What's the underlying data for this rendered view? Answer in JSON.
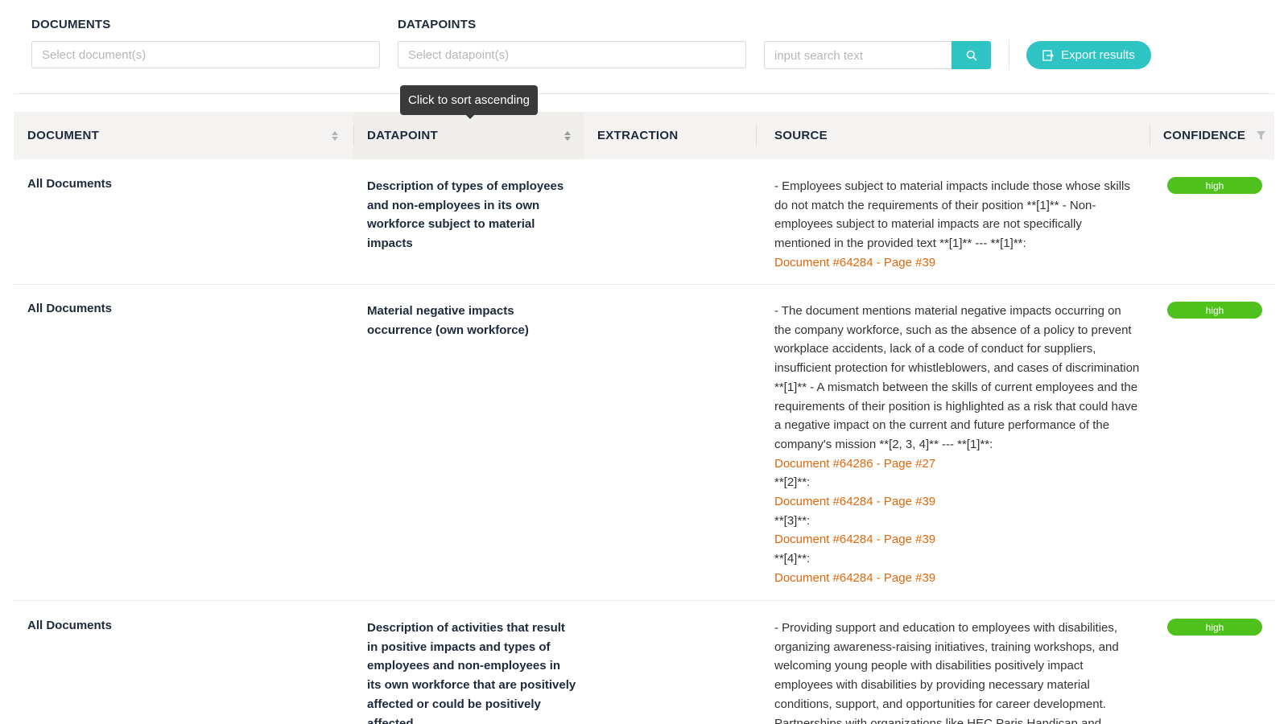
{
  "filters": {
    "documents_label": "DOCUMENTS",
    "documents_placeholder": "Select document(s)",
    "datapoints_label": "DATAPOINTS",
    "datapoints_placeholder": "Select datapoint(s)",
    "search_placeholder": "input search text",
    "export_label": "Export results"
  },
  "colors": {
    "accent": "#2fc4c4",
    "link": "#e2670a",
    "badge_high": "#4fc11d"
  },
  "tooltip": "Click to sort ascending",
  "table": {
    "headers": {
      "document": "DOCUMENT",
      "datapoint": "DATAPOINT",
      "extraction": "EXTRACTION",
      "source": "SOURCE",
      "confidence": "CONFIDENCE"
    },
    "rows": [
      {
        "document": "All Documents",
        "datapoint": "Description of types of employees and non-employees in its own workforce subject to material impacts",
        "extraction": "",
        "source_text": "- Employees subject to material impacts include those whose skills do not match the requirements of their position **[1]** - Non-employees subject to material impacts are not specifically mentioned in the provided text **[1]** --- **[1]**:",
        "refs": [
          "Document #64284 - Page #39"
        ],
        "confidence": "high"
      },
      {
        "document": "All Documents",
        "datapoint": "Material negative impacts occurrence (own workforce)",
        "extraction": "",
        "source_text": "- The document mentions material negative impacts occurring on the company workforce, such as the absence of a policy to prevent workplace accidents, lack of a code of conduct for suppliers, insufficient protection for whistleblowers, and cases of discrimination **[1]** - A mismatch between the skills of current employees and the requirements of their position is highlighted as a risk that could have a negative impact on the current and future performance of the company's mission **[2, 3, 4]** --- **[1]**:",
        "ref1": "Document #64286 - Page #27",
        "marker2": "**[2]**:",
        "ref2": "Document #64284 - Page #39",
        "marker3": "**[3]**:",
        "ref3": "Document #64284 - Page #39",
        "marker4": "**[4]**:",
        "ref4": "Document #64284 - Page #39",
        "confidence": "high"
      },
      {
        "document": "All Documents",
        "datapoint": "Description of activities that result in positive impacts and types of employees and non-employees in its own workforce that are positively affected or could be positively affected",
        "extraction": "",
        "source_text": "- Providing support and education to employees with disabilities, organizing awareness-raising initiatives, training workshops, and welcoming young people with disabilities positively impact employees with disabilities by providing necessary material conditions, support, and opportunities for career development. Partnerships with organizations like HEC Paris Handicap and",
        "confidence": "high"
      }
    ]
  }
}
